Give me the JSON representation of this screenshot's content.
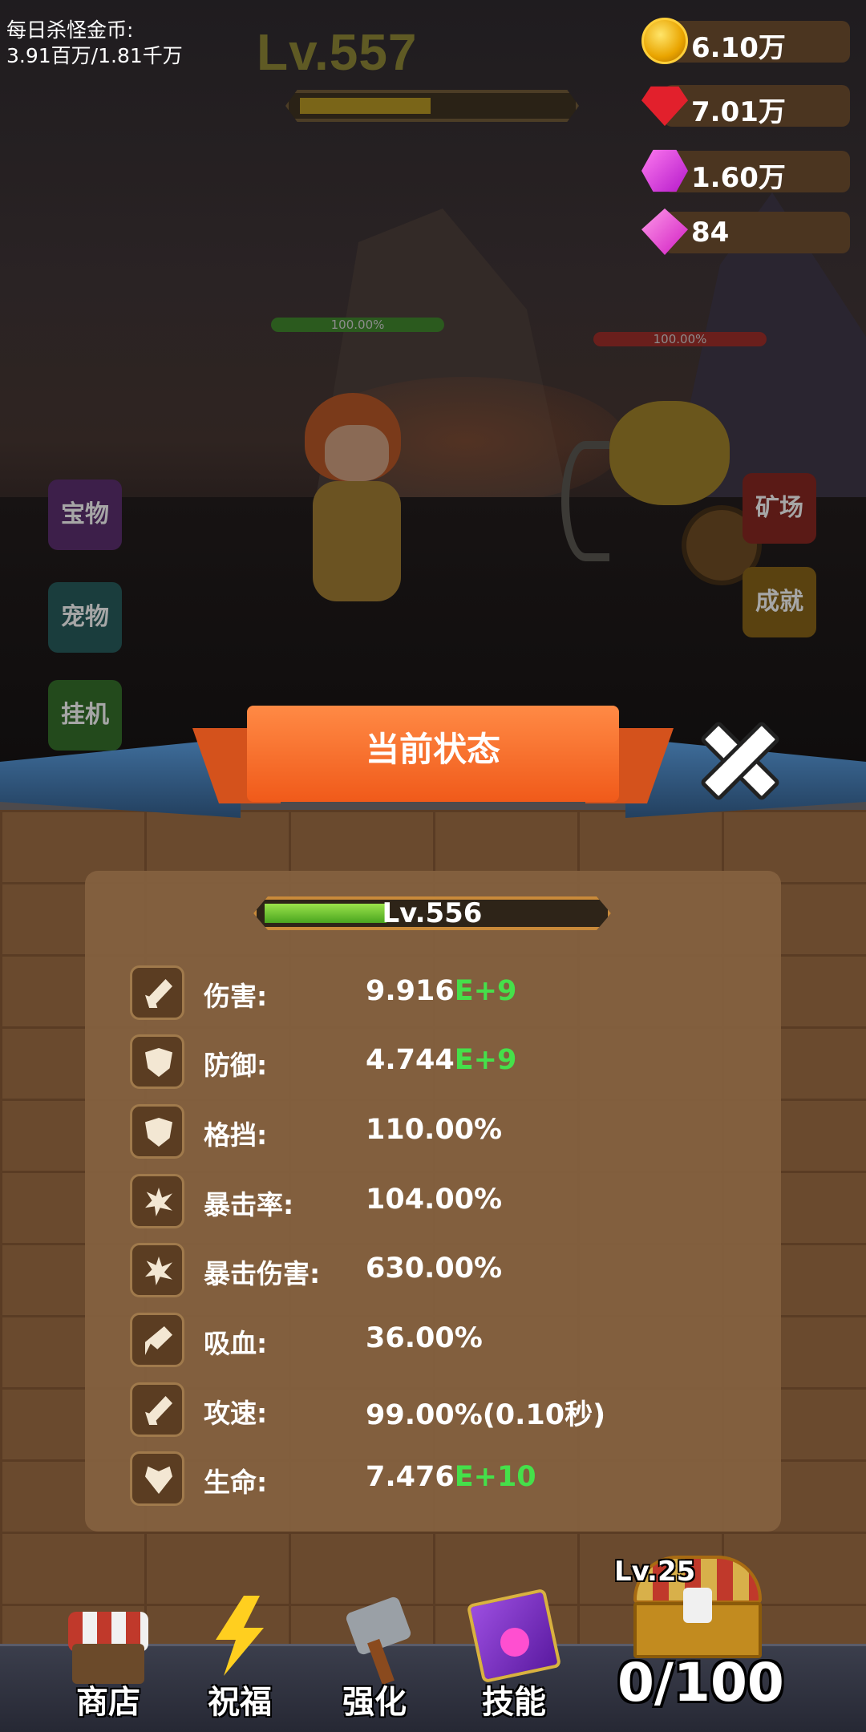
{
  "daily_kill_gold": {
    "label": "每日杀怪金币:",
    "value": "3.91百万/1.81千万"
  },
  "stage": {
    "level": "Lv.557",
    "progress_fraction": 0.5
  },
  "currencies": [
    {
      "name": "gold-coin",
      "value": "6.10万",
      "color": "#f5b400"
    },
    {
      "name": "ruby",
      "value": "7.01万",
      "color": "#e2202c"
    },
    {
      "name": "purple-crystal",
      "value": "1.60万",
      "color": "#c02fd6"
    },
    {
      "name": "diamond",
      "value": "84",
      "color": "#e02ad2"
    }
  ],
  "battle": {
    "hero_hp": "100.00%",
    "enemy_hp": "100.00%"
  },
  "side_menu": {
    "left": [
      "宝物",
      "宠物",
      "挂机"
    ],
    "right": [
      "矿场",
      "成就"
    ]
  },
  "status_panel": {
    "title": "当前状态",
    "level": "Lv.556",
    "level_progress_fraction": 0.37,
    "stats": [
      {
        "icon": "sword-icon",
        "label": "伤害:",
        "value_main": "9.916",
        "value_exp": "E+9"
      },
      {
        "icon": "shield-icon",
        "label": "防御:",
        "value_main": "4.744",
        "value_exp": "E+9"
      },
      {
        "icon": "block-shield-icon",
        "label": "格挡:",
        "value_main": "110.00%",
        "value_exp": ""
      },
      {
        "icon": "crit-burst-icon",
        "label": "暴击率:",
        "value_main": "104.00%",
        "value_exp": ""
      },
      {
        "icon": "crit-damage-icon",
        "label": "暴击伤害:",
        "value_main": "630.00%",
        "value_exp": ""
      },
      {
        "icon": "lifesteal-icon",
        "label": "吸血:",
        "value_main": "36.00%",
        "value_exp": ""
      },
      {
        "icon": "attack-speed-icon",
        "label": "攻速:",
        "value_main": "99.00%(0.10秒)",
        "value_exp": ""
      },
      {
        "icon": "heart-plus-icon",
        "label": "生命:",
        "value_main": "7.476",
        "value_exp": "E+10"
      }
    ]
  },
  "bottom_nav": [
    {
      "label": "商店",
      "icon": "shop-stall-icon"
    },
    {
      "label": "祝福",
      "icon": "lightning-icon"
    },
    {
      "label": "强化",
      "icon": "hammer-icon"
    },
    {
      "label": "技能",
      "icon": "spellbook-icon"
    }
  ],
  "chest": {
    "level": "Lv.25",
    "count": "0/100"
  }
}
